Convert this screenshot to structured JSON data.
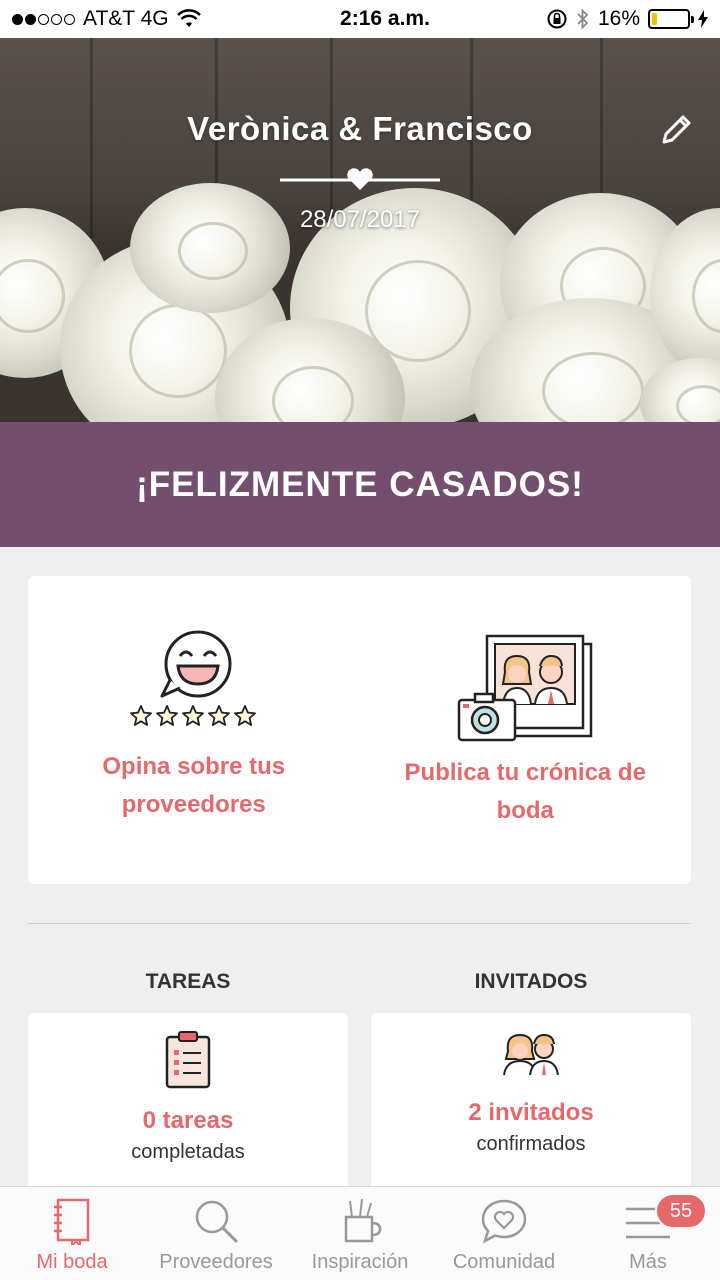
{
  "status_bar": {
    "carrier": "AT&T 4G",
    "time": "2:16 a.m.",
    "battery_percent": "16%",
    "battery_level": 0.16
  },
  "hero": {
    "couple_names": "Verònica & Francisco",
    "wedding_date": "28/07/2017"
  },
  "banner": {
    "text": "¡FELIZMENTE CASADOS!"
  },
  "actions": [
    {
      "label": "Opina sobre tus proveedores",
      "icon": "review-smiley-icon"
    },
    {
      "label": "Publica tu crónica de boda",
      "icon": "photo-album-camera-icon"
    }
  ],
  "tasks": {
    "heading": "TAREAS",
    "count": "0 tareas",
    "sub": "completadas"
  },
  "guests": {
    "heading": "INVITADOS",
    "count": "2 invitados",
    "sub": "confirmados"
  },
  "tabbar": {
    "items": [
      {
        "label": "Mi boda",
        "icon": "notebook-icon",
        "active": true
      },
      {
        "label": "Proveedores",
        "icon": "search-icon",
        "active": false
      },
      {
        "label": "Inspiración",
        "icon": "pencil-cup-icon",
        "active": false
      },
      {
        "label": "Comunidad",
        "icon": "chat-heart-icon",
        "active": false
      },
      {
        "label": "Más",
        "icon": "menu-icon",
        "active": false
      }
    ],
    "more_badge": "55"
  },
  "colors": {
    "accent": "#e8676a",
    "banner": "#744e6e"
  }
}
